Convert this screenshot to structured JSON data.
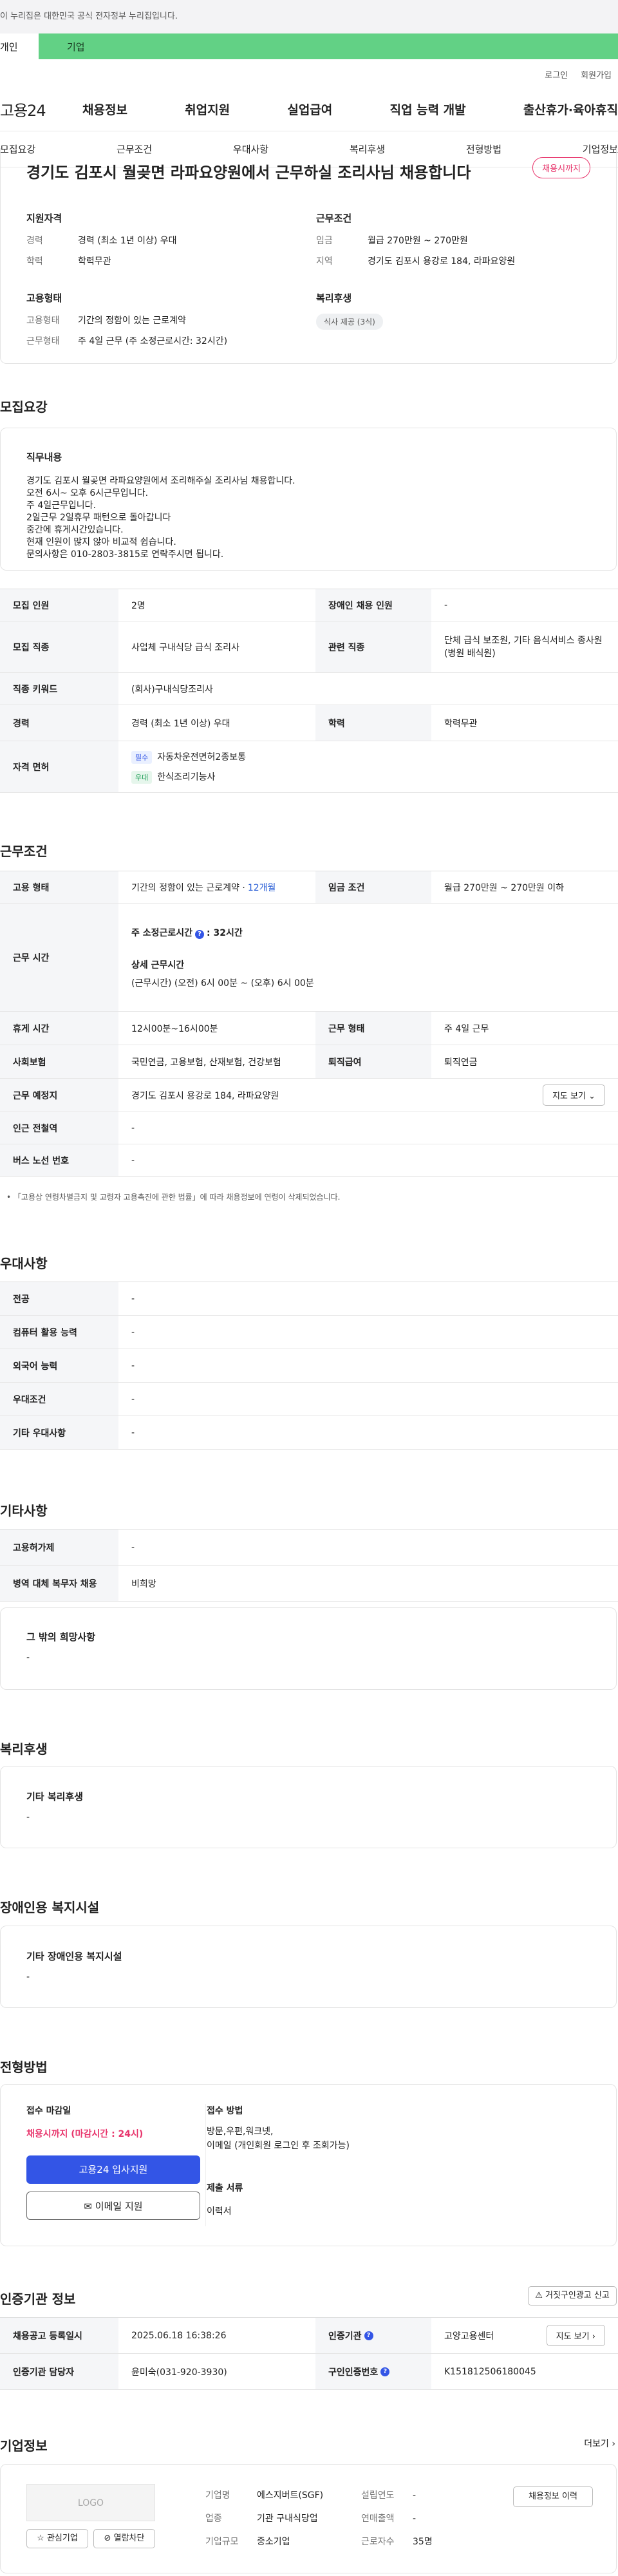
{
  "gov_banner": "이 누리집은 대한민국 공식 전자정부 누리집입니다.",
  "top_tabs": [
    "개인",
    "기업"
  ],
  "util_links": [
    "로그인",
    "회원가입"
  ],
  "logo": "고용24",
  "gnb": [
    "채용정보",
    "취업지원",
    "실업급여",
    "직업 능력 개발",
    "출산휴가·육아휴직"
  ],
  "subnav": [
    "모집요강",
    "근무조건",
    "우대사항",
    "복리후생",
    "전형방법",
    "기업정보"
  ],
  "header": {
    "title": "경기도 김포시 월곶면 라파요양원에서 근무하실 조리사님 채용합니다",
    "badge": "채용시까지",
    "qual_title": "지원자격",
    "qual": [
      {
        "k": "경력",
        "v": "경력 (최소 1년 이상) 우대"
      },
      {
        "k": "학력",
        "v": "학력무관"
      }
    ],
    "cond_title": "근무조건",
    "cond": [
      {
        "k": "임금",
        "v": "월급 270만원 ~ 270만원"
      },
      {
        "k": "지역",
        "v": "경기도 김포시 용강로 184, 라파요양원"
      }
    ],
    "emp_title": "고용형태",
    "emp": [
      {
        "k": "고용형태",
        "v": "기간의 정함이 있는 근로계약"
      },
      {
        "k": "근무형태",
        "v": "주 4일 근무 (주 소정근로시간: 32시간)"
      }
    ],
    "welfare_title": "복리후생",
    "welfare_chip": "식사 제공 (3식)"
  },
  "recruit": {
    "section": "모집요강",
    "job_title": "직무내용",
    "job_lines": [
      "경기도 김포시 월곶면 라파요양원에서 조리해주실 조리사님 채용합니다.",
      "오전 6시~ 오후 6시근무입니다.",
      "주 4일근무입니다.",
      "2일근무 2일휴무 패턴으로 돌아갑니다",
      "중간에 휴게시간있습니다.",
      "현재 인원이 많지 않아 비교적 쉽습니다.",
      "문의사항은 010-2803-3815로 연락주시면 됩니다."
    ],
    "rows": [
      {
        "k1": "모집 인원",
        "v1": "2명",
        "k2": "장애인 채용 인원",
        "v2": "-"
      },
      {
        "k1": "모집 직종",
        "v1": "사업체 구내식당 급식 조리사",
        "k2": "관련 직종",
        "v2": "단체 급식 보조원, 기타 음식서비스 종사원(병원 배식원)"
      },
      {
        "k1": "직종 키워드",
        "v1": "(회사)구내식당조리사"
      },
      {
        "k1": "경력",
        "v1": "경력 (최소 1년 이상) 우대",
        "k2": "학력",
        "v2": "학력무관"
      }
    ],
    "license_label": "자격 면허",
    "licenses": [
      {
        "tag": "필수",
        "name": "자동차운전면허2종보통"
      },
      {
        "tag": "우대",
        "name": "한식조리기능사"
      }
    ]
  },
  "work": {
    "section": "근무조건",
    "emp_type_label": "고용 형태",
    "emp_type": "기간의 정함이 있는 근로계약 · ",
    "emp_months": "12개월",
    "wage_label": "임금 조건",
    "wage": "월급 270만원 ~ 270만원 이하",
    "hours_label": "근무 시간",
    "weekly_label": "주 소정근로시간",
    "weekly_value": ": 32시간",
    "detail_label": "상세 근무시간",
    "detail_value": "(근무시간) (오전) 6시 00분 ~ (오후) 6시 00분",
    "rows": [
      {
        "k1": "휴게 시간",
        "v1": "12시00분~16시00분",
        "k2": "근무 형태",
        "v2": "주 4일 근무"
      },
      {
        "k1": "사회보험",
        "v1": "국민연금, 고용보험, 산재보험, 건강보험",
        "k2": "퇴직급여",
        "v2": "퇴직연금"
      }
    ],
    "place_label": "근무 예정지",
    "place": "경기도 김포시 용강로 184, 라파요양원",
    "map_btn": "지도 보기",
    "subway_label": "인근 전철역",
    "subway": "-",
    "bus_label": "버스 노선 번호",
    "bus": "-",
    "note": "「고용상 연령차별금지 및 고령자 고용촉진에 관한 법률」에 따라 채용정보에 연령이 삭제되었습니다."
  },
  "pref": {
    "section": "우대사항",
    "rows": [
      {
        "k": "전공",
        "v": "-"
      },
      {
        "k": "컴퓨터 활용 능력",
        "v": "-"
      },
      {
        "k": "외국어 능력",
        "v": "-"
      },
      {
        "k": "우대조건",
        "v": "-"
      },
      {
        "k": "기타 우대사항",
        "v": "-"
      }
    ]
  },
  "etc": {
    "section": "기타사항",
    "rows": [
      {
        "k": "고용허가제",
        "v": "-"
      },
      {
        "k": "병역 대체 복무자 채용",
        "v": "비희망"
      }
    ],
    "other_title": "그 밖의 희망사항",
    "other_value": "-"
  },
  "welfare": {
    "section": "복리후생",
    "title": "기타 복리후생",
    "value": "-"
  },
  "disability": {
    "section": "장애인용 복지시설",
    "title": "기타 장애인용 복지시설",
    "value": "-"
  },
  "screening": {
    "section": "전형방법",
    "deadline_label": "접수 마감일",
    "deadline_value": "채용시까지 (마감시간 : 24시)",
    "apply_btn": "고용24 입사지원",
    "email_btn": "이메일 지원",
    "method_label": "접수 방법",
    "method_lines": [
      "방문,우편,워크넷,",
      "이메일 (개인회원 로그인 후 조회가능)"
    ],
    "docs_label": "제출 서류",
    "docs_value": "이력서"
  },
  "agency": {
    "section": "인증기관 정보",
    "report_btn": "거짓구인광고 신고",
    "rows": [
      {
        "k1": "채용공고 등록일시",
        "v1": "2025.06.18 16:38:26",
        "k2": "인증기관",
        "v2": "고양고용센터"
      },
      {
        "k1": "인증기관 담당자",
        "v1": "윤미숙(031-920-3930)",
        "k2": "구인인증번호",
        "v2": "K151812506180045"
      }
    ],
    "map_btn": "지도 보기"
  },
  "company": {
    "section": "기업정보",
    "more": "더보기",
    "logo": "LOGO",
    "fav_btn": "관심기업",
    "block_btn": "열람차단",
    "cols": [
      [
        {
          "k": "기업명",
          "v": "에스지버트(SGF)"
        },
        {
          "k": "업종",
          "v": "기관 구내식당업"
        },
        {
          "k": "기업규모",
          "v": "중소기업"
        }
      ],
      [
        {
          "k": "설립연도",
          "v": "-"
        },
        {
          "k": "연매출액",
          "v": "-"
        },
        {
          "k": "근로자수",
          "v": "35명"
        }
      ]
    ],
    "recruit_btn": "채용정보 이력"
  }
}
